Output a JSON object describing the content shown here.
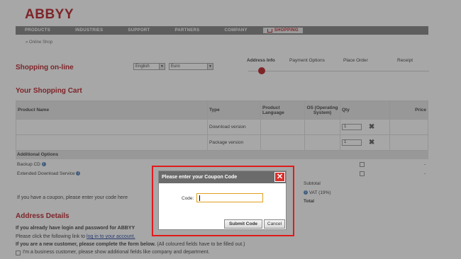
{
  "logo": "ABBYY",
  "nav": [
    "PRODUCTS",
    "INDUSTRIES",
    "SUPPORT",
    "PARTNERS",
    "COMPANY"
  ],
  "nav_shopping": "SHOPPING",
  "breadcrumb": "» Online Shop",
  "shopping_title": "Shopping on-line",
  "language_select": "English",
  "currency_select": "Euro",
  "steps": [
    "Address Info",
    "Payment Options",
    "Place Order",
    "Receipt"
  ],
  "cart_title": "Your Shopping Cart",
  "table_headers": {
    "name": "Product Name",
    "type": "Type",
    "lang": "Product Language",
    "os": "OS (Operating System)",
    "qty": "Qty",
    "price": "Price"
  },
  "rows": [
    {
      "type": "Download version",
      "qty": "1"
    },
    {
      "type": "Package version",
      "qty": "1"
    }
  ],
  "additional_options": "Additional Options",
  "options": [
    {
      "label": "Backup CD",
      "price": "-"
    },
    {
      "label": "Extended Download Service",
      "price": "-"
    }
  ],
  "coupon_text": "If you have a coupon, please enter your code here",
  "totals": {
    "subtotal": "Subtotal",
    "vat": "VAT (19%)",
    "total": "Total"
  },
  "address_title": "Address Details",
  "address_line1": "If you already have login and password for ABBYY",
  "address_line2_pre": "Please click the following link to",
  "address_line2_link": "log in to your account.",
  "address_line3_bold": "If you are a new customer, please complete the form below.",
  "address_line3_rest": "(All coloured fields have to be filled out.)",
  "business_checkbox": "I'm a business customer, please show additional fields like company and department.",
  "dialog": {
    "title": "Please enter your Coupon Code",
    "close": "✕",
    "code_label": "Code:",
    "code_value": "",
    "submit": "Submit Code",
    "cancel": "Cancel"
  }
}
